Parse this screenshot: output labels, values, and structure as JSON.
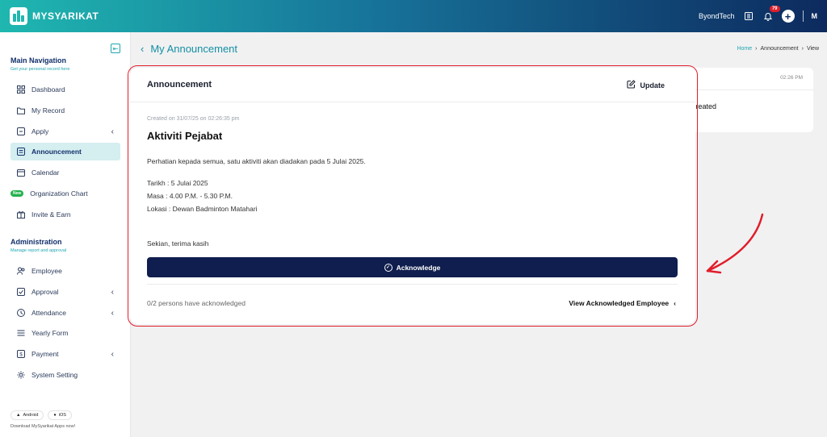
{
  "app": {
    "name": "MYSYARIKAT"
  },
  "topbar": {
    "company": "ByondTech",
    "notification_count": "79",
    "avatar_initials": "M"
  },
  "sidebar": {
    "main_title": "Main Navigation",
    "main_subtitle": "Get your personal record here",
    "main_items": [
      {
        "label": "Dashboard",
        "icon": "grid-icon"
      },
      {
        "label": "My Record",
        "icon": "folder-icon"
      },
      {
        "label": "Apply",
        "icon": "apply-icon",
        "has_children": true
      },
      {
        "label": "Announcement",
        "icon": "announcement-icon",
        "active": true
      },
      {
        "label": "Calendar",
        "icon": "calendar-icon"
      },
      {
        "label": "Organization Chart",
        "icon": "new-badge",
        "badge": "New"
      },
      {
        "label": "Invite & Earn",
        "icon": "gift-icon"
      }
    ],
    "admin_title": "Administration",
    "admin_subtitle": "Manage report and approval",
    "admin_items": [
      {
        "label": "Employee",
        "icon": "users-icon"
      },
      {
        "label": "Approval",
        "icon": "check-square-icon",
        "has_children": true
      },
      {
        "label": "Attendance",
        "icon": "clock-icon",
        "has_children": true
      },
      {
        "label": "Yearly Form",
        "icon": "form-icon"
      },
      {
        "label": "Payment",
        "icon": "payment-icon",
        "has_children": true
      },
      {
        "label": "System Setting",
        "icon": "gear-icon"
      }
    ],
    "android_label": "Android",
    "ios_label": "iOS",
    "download_note": "Download MySyarikat Apps now!"
  },
  "header": {
    "title": "My Announcement",
    "breadcrumb": [
      "Home",
      "Announcement",
      "View"
    ]
  },
  "background_card": {
    "time": "02:26 PM",
    "text": "created"
  },
  "announcement": {
    "heading": "Announcement",
    "update_label": "Update",
    "created": "Created on 31/07/25 on 02:26:35 pm",
    "title": "Aktiviti Pejabat",
    "lines": [
      "Perhatian kepada semua, satu aktiviti akan diadakan pada 5 Julai 2025.",
      "Tarikh : 5 Julai 2025",
      "Masa : 4.00 P.M. - 5.30 P.M.",
      "Lokasi : Dewan Badminton Matahari",
      "Sekian, terima kasih"
    ],
    "acknowledge_label": "Acknowledge",
    "ack_count": "0/2 persons have acknowledged",
    "view_ack_label": "View Acknowledged Employee"
  },
  "colors": {
    "accent": "#1fa6b0",
    "primary_dark": "#0f1e4e",
    "annotation_red": "#e11d2a"
  }
}
